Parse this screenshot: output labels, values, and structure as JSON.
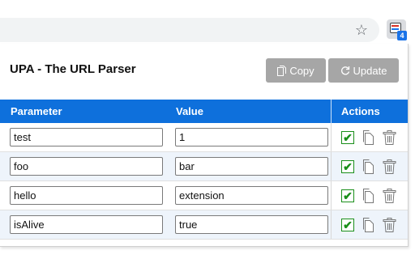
{
  "browser": {
    "extension_badge": "4"
  },
  "popup": {
    "title": "UPA - The URL Parser",
    "copy_label": "Copy",
    "update_label": "Update"
  },
  "table": {
    "headers": {
      "parameter": "Parameter",
      "value": "Value",
      "actions": "Actions"
    },
    "rows": [
      {
        "parameter": "test",
        "value": "1",
        "checked": true
      },
      {
        "parameter": "foo",
        "value": "bar",
        "checked": true
      },
      {
        "parameter": "hello",
        "value": "extension",
        "checked": true
      },
      {
        "parameter": "isAlive",
        "value": "true",
        "checked": true
      }
    ]
  },
  "colors": {
    "header_bg": "#0e70dc",
    "button_bg": "#a6a6a6",
    "check_green": "#1a8f1a",
    "alt_row": "#eef4fb"
  },
  "icons": [
    "star-icon",
    "extension-icon",
    "copy-icon",
    "refresh-icon",
    "checkbox-icon",
    "document-copy-icon",
    "trash-icon"
  ]
}
